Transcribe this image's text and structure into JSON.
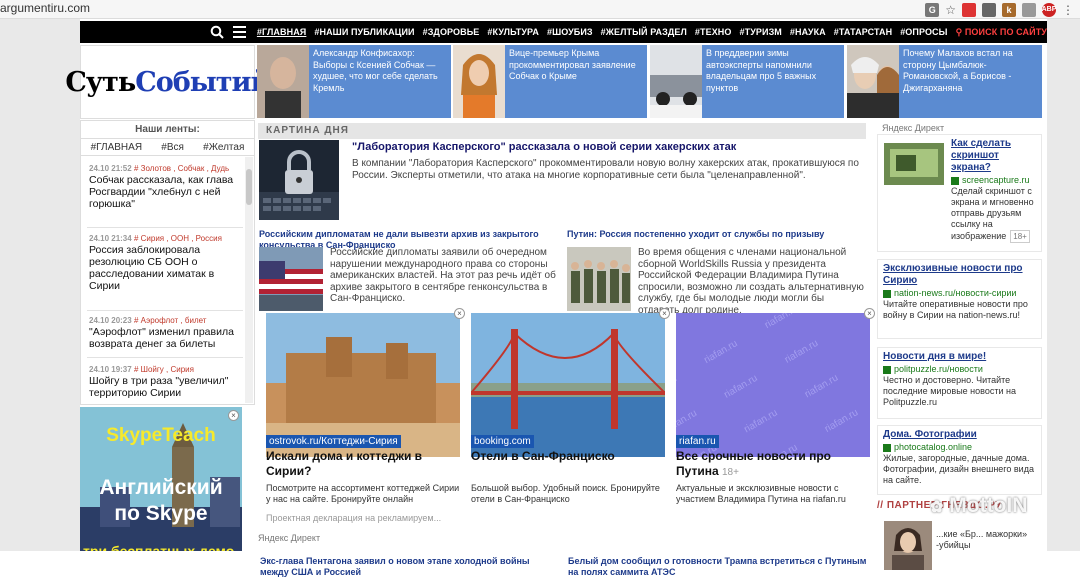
{
  "browser": {
    "url": "argumentiru.com",
    "ext_abp": "ABP"
  },
  "nav": {
    "links": [
      "#ГЛАВНАЯ",
      "#НАШИ ПУБЛИКАЦИИ",
      "#ЗДОРОВЬЕ",
      "#КУЛЬТУРА",
      "#ШОУБИЗ",
      "#ЖЕЛТЫЙ РАЗДЕЛ",
      "#ТЕХНО",
      "#ТУРИЗМ",
      "#НАУКА",
      "#ТАТАРСТАН",
      "#ОПРОСЫ"
    ],
    "search": "ПОИСК ПО САЙТУ"
  },
  "logo": {
    "part1": "Суть ",
    "part2": "Событий"
  },
  "top_news": [
    {
      "text": "Александр Конфисахор: Выборы с Ксенией Собчак — худшее, что мог себе сделать Кремль"
    },
    {
      "text": "Вице-премьер Крыма прокомментировал заявление Собчак о Крыме"
    },
    {
      "text": "В преддверии зимы автоэксперты напомнили владельцам про 5 важных пунктов"
    },
    {
      "text": "Почему Малахов встал на сторону Цымбалюк-Романовской, а Борисов - Джигарханяна"
    }
  ],
  "feeds": {
    "header": "Наши ленты:",
    "tabs": [
      "#ГЛАВНАЯ",
      "#Вся",
      "#Желтая"
    ],
    "items": [
      {
        "date": "24.10 21:52",
        "tags": "Золотов , Собчак , Дудь",
        "title": "Собчак рассказала, как глава Росгвардии \"хлебнул с ней горюшка\""
      },
      {
        "date": "24.10 21:34",
        "tags": "Сирия , ООН , Россия",
        "title": "Россия заблокировала резолюцию СБ ООН о расследовании химатак в Сирии"
      },
      {
        "date": "24.10 20:23",
        "tags": "Аэрофлот , билет",
        "title": "\"Аэрофлот\" изменил правила возврата денег за билеты"
      },
      {
        "date": "24.10 19:37",
        "tags": "Шойгу , Сирия",
        "title": "Шойгу в три раза \"увеличил\" территорию Сирии"
      }
    ]
  },
  "skype_ad": {
    "title": "SkypeTeach",
    "line1": "Английский",
    "line2": "по Skype",
    "line3": "три бесплатных демо-урока"
  },
  "kartina": {
    "label": "КАРТИНА ДНЯ",
    "title": "\"Лаборатория Касперского\" рассказала о новой серии хакерских атак",
    "text": "В компании \"Лаборатория Касперского\" прокомментировали новую волну хакерских атак, прокатившуюся по России. Эксперты отметили, что атака на многие корпоративные сети была \"целенаправленной\"."
  },
  "sub1": {
    "title": "Российским дипломатам не дали вывезти архив из закрытого консульства в Сан-Франциско",
    "text": "Российские дипломаты заявили об очередном нарушении международного права со стороны американских властей. На этот раз речь идёт об архиве закрытого в сентябре генконсульства в Сан-Франциско."
  },
  "sub2": {
    "title": "Путин: Россия постепенно уходит от службы по призыву",
    "text": "Во время общения с членами национальной сборной WorldSkills Russia у президента Российской Федерации Владимира Путина спросили, возможно ли создать альтернативную службу, где бы молодые люди могли бы отдавать долг родине."
  },
  "ads": [
    {
      "tag": "ostrovok.ru/Коттеджи-Сирия",
      "title": "Искали дома и коттеджи в Сирии?",
      "age": "",
      "desc": "Посмотрите на ассортимент коттеджей Сирии у нас на сайте. Бронируйте онлайн",
      "desc2": "Проектная декларация на рекламируем..."
    },
    {
      "tag": "booking.com",
      "title": "Отели в Сан-Франциско",
      "age": "",
      "desc": "Большой выбор. Удобный поиск. Бронируйте отели в Сан-Франциско",
      "desc2": ""
    },
    {
      "tag": "riafan.ru",
      "title": "Все срочные новости про Путина",
      "age": "18+",
      "desc": "Актуальные и эксклюзивные новости с участием Владимира Путина на riafan.ru",
      "desc2": ""
    }
  ],
  "riafan_wm": "riafan.ru",
  "yandex_direct": "Яндекс Директ",
  "bottom": {
    "left": "Экс-глава Пентагона заявил о новом этапе холодной войны между США и Россией",
    "right": "Белый дом сообщил о готовности Трампа встретиться с Путиным на полях саммита АТЭС"
  },
  "right_ads": [
    {
      "title": "Как сделать скриншот экрана?",
      "domain": "screencapture.ru",
      "desc": "Сделай скриншот с экрана и мгновенно отправь друзьям ссылку на изображение",
      "age": "18+"
    },
    {
      "title": "Эксклюзивные новости про Сирию",
      "domain": "nation-news.ru/новости-сирии",
      "desc": "Читайте оперативные новости про войну в Сирии на nation-news.ru!",
      "age": ""
    },
    {
      "title": "Новости дня в мире!",
      "domain": "politpuzzle.ru/новости",
      "desc": "Честно и достоверно. Читайте последние мировые новости на Politpuzzle.ru",
      "age": ""
    },
    {
      "title": "Дома. Фотографии",
      "domain": "photocatalog.online",
      "desc": "Жилые, загородные, дачные дома. Фотографии, дизайн внешнего вида на сайте.",
      "age": ""
    }
  ],
  "partner": {
    "title": "// ПАРТНЕР ГНЕЗДО.РУ",
    "text": "...кие «Бр... мажорки» -убийцы"
  },
  "watermark": "MottoIN"
}
